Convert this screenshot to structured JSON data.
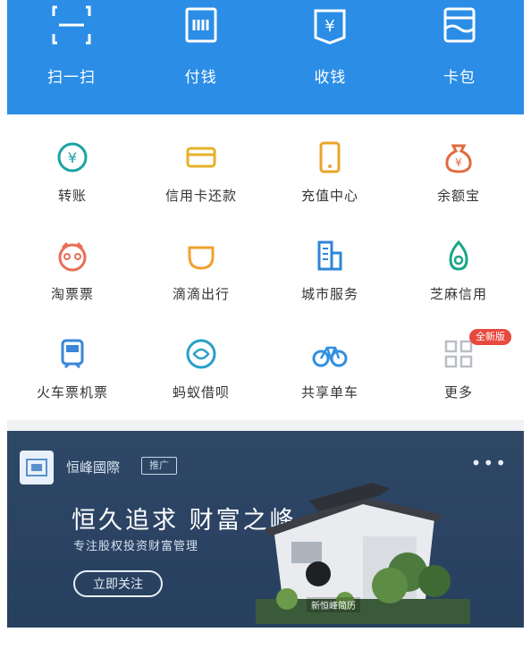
{
  "top_actions": [
    {
      "label": "扫一扫",
      "icon": "scan-icon"
    },
    {
      "label": "付钱",
      "icon": "pay-code-icon"
    },
    {
      "label": "收钱",
      "icon": "receive-money-icon"
    },
    {
      "label": "卡包",
      "icon": "card-wallet-icon"
    }
  ],
  "services": [
    {
      "label": "转账",
      "icon": "transfer-icon",
      "color": "#1aa3a3"
    },
    {
      "label": "信用卡还款",
      "icon": "credit-card-icon",
      "color": "#e6b12a"
    },
    {
      "label": "充值中心",
      "icon": "phone-topup-icon",
      "color": "#e9a62b"
    },
    {
      "label": "余额宝",
      "icon": "money-bag-icon",
      "color": "#e26a3d"
    },
    {
      "label": "淘票票",
      "icon": "movie-ticket-icon",
      "color": "#e86f56"
    },
    {
      "label": "滴滴出行",
      "icon": "taxi-icon",
      "color": "#f0a22d"
    },
    {
      "label": "城市服务",
      "icon": "city-building-icon",
      "color": "#2f86d6"
    },
    {
      "label": "芝麻信用",
      "icon": "sesame-credit-icon",
      "color": "#1aa687"
    },
    {
      "label": "火车票机票",
      "icon": "train-icon",
      "color": "#3b86d8"
    },
    {
      "label": "蚂蚁借呗",
      "icon": "ant-loan-icon",
      "color": "#2aa0c8"
    },
    {
      "label": "共享单车",
      "icon": "bicycle-icon",
      "color": "#2f90e0"
    },
    {
      "label": "更多",
      "icon": "more-grid-icon",
      "color": "#b9bec6",
      "badge": "全新版"
    }
  ],
  "ad": {
    "brand": "恒峰國際",
    "tag": "推广",
    "title": "恒久追求 财富之峰",
    "subtitle": "专注股权投资财富管理",
    "button": "立即关注",
    "caption": "新恒峰简历",
    "more": "•••",
    "bg": "#2f4866"
  },
  "colors": {
    "accent": "#2b8de6",
    "badge": "#e8483d"
  }
}
